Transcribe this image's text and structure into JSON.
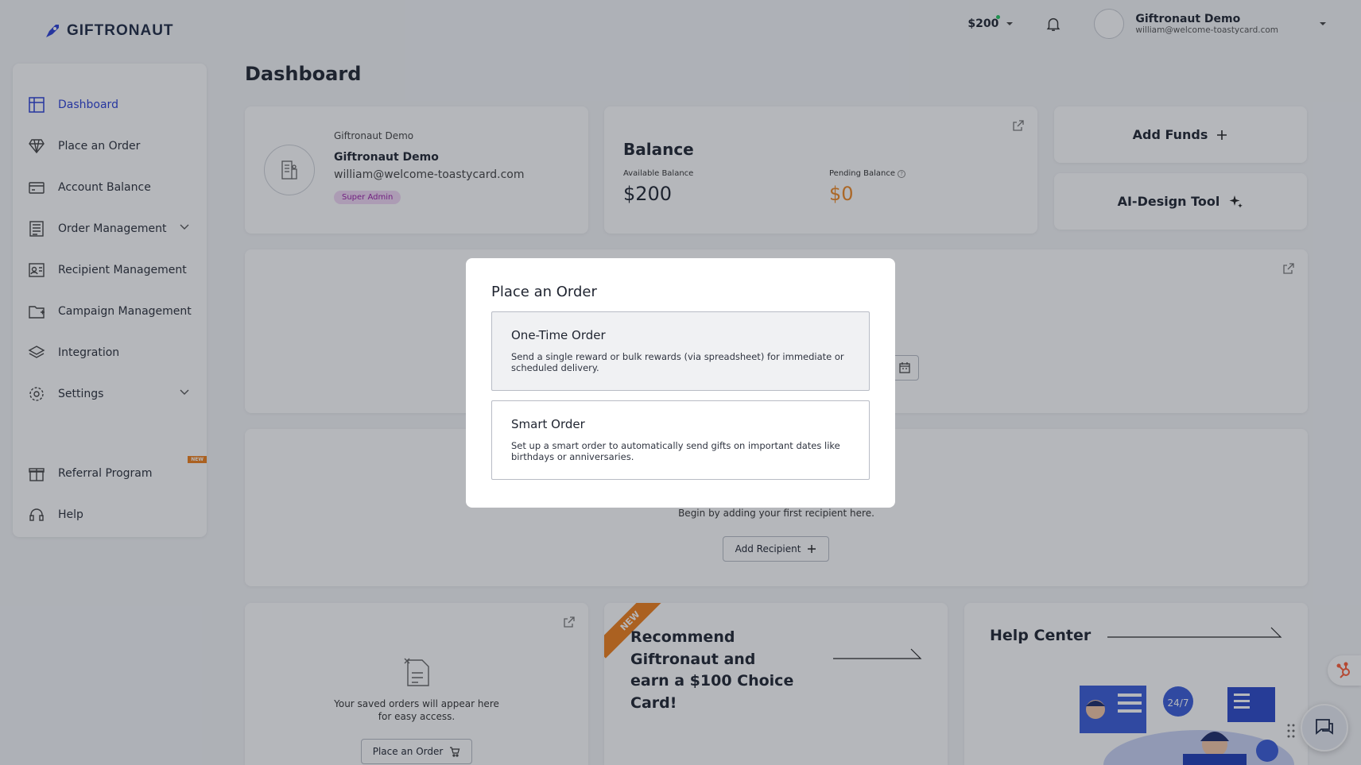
{
  "brand": {
    "name": "GIFTRONAUT",
    "accent": "#2b3fd6"
  },
  "topbar": {
    "balance": "$200",
    "user_name": "Giftronaut Demo",
    "user_email": "william@welcome-toastycard.com"
  },
  "sidebar": {
    "items": [
      {
        "label": "Dashboard",
        "icon": "dashboard-icon",
        "active": true
      },
      {
        "label": "Place an Order",
        "icon": "diamond-icon"
      },
      {
        "label": "Account Balance",
        "icon": "credit-card-icon"
      },
      {
        "label": "Order Management",
        "icon": "list-icon",
        "expandable": true
      },
      {
        "label": "Recipient Management",
        "icon": "contacts-icon"
      },
      {
        "label": "Campaign Management",
        "icon": "folder-icon"
      },
      {
        "label": "Integration",
        "icon": "layers-icon"
      },
      {
        "label": "Settings",
        "icon": "gear-icon",
        "expandable": true
      }
    ],
    "bottom_items": [
      {
        "label": "Referral Program",
        "icon": "gift-icon",
        "badge": "NEW"
      },
      {
        "label": "Help",
        "icon": "headset-icon"
      }
    ]
  },
  "page": {
    "title": "Dashboard"
  },
  "profile_card": {
    "org": "Giftronaut Demo",
    "name": "Giftronaut Demo",
    "email": "william@welcome-toastycard.com",
    "role": "Super Admin"
  },
  "balance_card": {
    "title": "Balance",
    "available_label": "Available Balance",
    "available_value": "$200",
    "pending_label": "Pending Balance",
    "pending_value": "$0",
    "pending_color": "#f08a24"
  },
  "actions": {
    "add_funds": "Add Funds",
    "ai_design": "AI-Design Tool"
  },
  "recipients_card": {
    "empty_text": "Begin by adding your first recipient here.",
    "add_button": "Add Recipient"
  },
  "saved_orders_card": {
    "empty_text_line1": "Your saved orders will appear here",
    "empty_text_line2": "for easy access.",
    "button": "Place an Order"
  },
  "referral_card": {
    "ribbon": "NEW",
    "title": "Recommend Giftronaut and earn a $100 Choice Card!"
  },
  "help_card": {
    "title": "Help Center"
  },
  "modal": {
    "title": "Place an Order",
    "options": [
      {
        "title": "One-Time Order",
        "description": "Send a single reward or bulk rewards (via spreadsheet) for immediate or scheduled delivery.",
        "selected": true
      },
      {
        "title": "Smart Order",
        "description": "Set up a smart order to automatically send gifts on important dates like birthdays or anniversaries.",
        "selected": false
      }
    ]
  }
}
